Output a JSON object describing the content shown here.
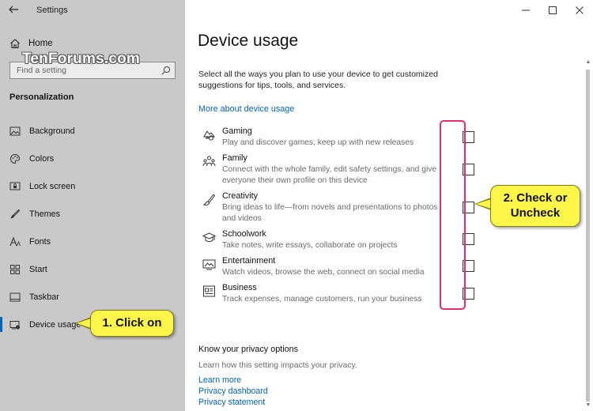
{
  "window": {
    "title": "Settings"
  },
  "sidebar": {
    "home_label": "Home",
    "watermark": "TenForums.com",
    "search": {
      "placeholder": "Find a setting",
      "value": ""
    },
    "section": "Personalization",
    "items": [
      {
        "label": "Background",
        "icon": "background-icon"
      },
      {
        "label": "Colors",
        "icon": "colors-icon"
      },
      {
        "label": "Lock screen",
        "icon": "lock-screen-icon"
      },
      {
        "label": "Themes",
        "icon": "themes-icon"
      },
      {
        "label": "Fonts",
        "icon": "fonts-icon"
      },
      {
        "label": "Start",
        "icon": "start-icon"
      },
      {
        "label": "Taskbar",
        "icon": "taskbar-icon"
      },
      {
        "label": "Device usage",
        "icon": "device-usage-icon",
        "selected": true
      }
    ]
  },
  "main": {
    "title": "Device usage",
    "intro": "Select all the ways you plan to use your device to get customized suggestions for tips, tools, and services.",
    "more_link": "More about device usage",
    "options": [
      {
        "title": "Gaming",
        "desc": "Play and discover games, keep up with new releases",
        "checked": false,
        "icon": "gaming-icon"
      },
      {
        "title": "Family",
        "desc": "Connect with the whole family, edit safety settings, and give everyone their own profile on this device",
        "checked": false,
        "icon": "family-icon"
      },
      {
        "title": "Creativity",
        "desc": "Bring ideas to life—from novels and presentations to photos and videos",
        "checked": false,
        "icon": "creativity-icon"
      },
      {
        "title": "Schoolwork",
        "desc": "Take notes, write essays, collaborate on projects",
        "checked": false,
        "icon": "schoolwork-icon"
      },
      {
        "title": "Entertainment",
        "desc": "Watch videos, browse the web, connect on social media",
        "checked": false,
        "icon": "entertainment-icon"
      },
      {
        "title": "Business",
        "desc": "Track expenses, manage customers, run your business",
        "checked": false,
        "icon": "business-icon"
      }
    ],
    "privacy": {
      "heading": "Know your privacy options",
      "desc": "Learn how this setting impacts your privacy.",
      "links": [
        "Learn more",
        "Privacy dashboard",
        "Privacy statement"
      ]
    }
  },
  "callouts": {
    "one": "1. Click on",
    "two_line1": "2. Check or",
    "two_line2": "Uncheck"
  },
  "colors": {
    "sidebar_bg": "#c9c9c9",
    "link": "#0063b1",
    "accent": "#0067c0",
    "highlight_border": "#e0306a",
    "callout_fill": "#fff64a"
  }
}
